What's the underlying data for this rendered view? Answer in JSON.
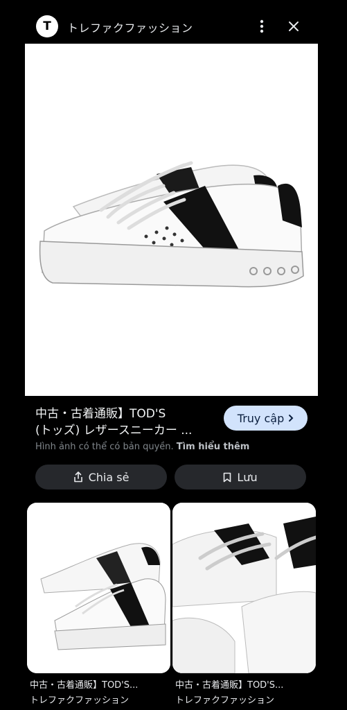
{
  "header": {
    "avatar_letter": "T",
    "site_name": "トレファクファッション"
  },
  "result": {
    "title_line1": "中古・古着通販】TOD'S",
    "title_line2": "(トッズ) レザースニーカー ...",
    "visit_label": "Truy cập",
    "copyright_text": "Hình ảnh có thể có bản quyền.",
    "learn_more": "Tìm hiểu thêm",
    "share_label": "Chia sẻ",
    "save_label": "Lưu"
  },
  "related": [
    {
      "title": "中古・古着通販】TOD'S...",
      "source": "トレファクファッション"
    },
    {
      "title": "中古・古着通販】TOD'S...",
      "source": "トレファクファッション"
    }
  ],
  "colors": {
    "background": "#000000",
    "visit_button": "#d2e3fc",
    "pill_button": "#26282c"
  }
}
